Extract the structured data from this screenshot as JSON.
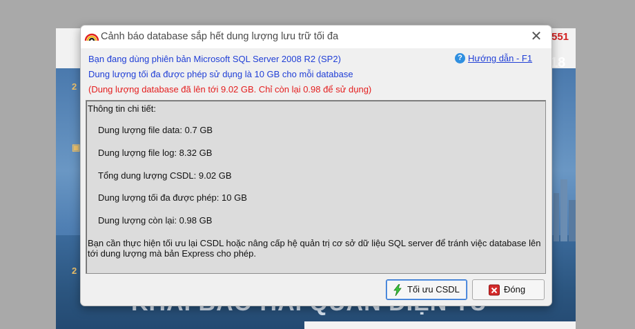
{
  "background": {
    "hotline_fragment": "551",
    "year_fragment": "18",
    "banner_text": "KHAI BÁO HẢI QUAN ĐIỆN TỬ"
  },
  "dialog": {
    "title": "Cảnh báo database sắp hết dung lượng lưu trữ tối đa",
    "close_glyph": "✕",
    "info": {
      "version_line": "Bạn đang dùng phiên bản Microsoft SQL Server 2008 R2 (SP2)",
      "limit_line": "Dung lượng tối đa được phép sử dụng là 10 GB cho mỗi database",
      "warning_line": "(Dung lượng database đã lên tới 9.02 GB. Chỉ còn lại 0.98 để sử dụng)"
    },
    "help": {
      "icon": "question-icon",
      "icon_glyph": "?",
      "label": "Hướng dẫn - F1"
    },
    "details": {
      "title": "Thông tin chi tiết:",
      "rows": [
        "Dung lượng file data: 0.7 GB",
        "Dung lượng file log: 8.32 GB",
        "Tổng dung lượng CSDL: 9.02 GB",
        "Dung lượng tối đa được phép: 10 GB",
        "Dung lượng còn lại: 0.98 GB"
      ],
      "note": "Bạn cần thực hiện tối ưu lại CSDL hoặc nâng cấp hệ quản trị cơ sở dữ liệu SQL server để tránh việc database lên tới dung lượng mà bản Express cho phép."
    },
    "buttons": {
      "optimize": "Tối ưu CSDL",
      "close": "Đóng"
    },
    "colors": {
      "info_blue": "#1f3ed6",
      "warning_red": "#e41d1d",
      "link_blue": "#1f3ed6"
    }
  }
}
